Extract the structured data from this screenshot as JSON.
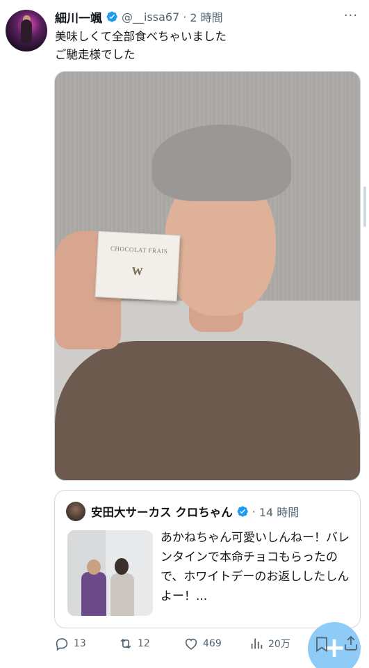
{
  "post": {
    "author_name": "細川一颯",
    "handle": "@__issa67",
    "separator": "·",
    "time": "2 時間",
    "more": "···",
    "text_line1": "美味しくて全部食べちゃいました",
    "text_line2": "ご馳走様でした",
    "media": {
      "box_text": "CHOCOLAT FRAIS",
      "box_logo": "W"
    }
  },
  "quote": {
    "author_name": "安田大サーカス クロちゃん",
    "separator": "·",
    "time": "14 時間",
    "text": "あかねちゃん可愛いしんねー！バレンタインで本命チョコもらったので、ホワイトデーのお返ししたしんよー！..."
  },
  "actions": {
    "replies": "13",
    "reposts": "12",
    "likes": "469",
    "views": "20万"
  },
  "fab": {
    "label": "+"
  },
  "colors": {
    "verified": "#1d9bf0",
    "secondary_text": "#536471",
    "fab": "#8fcbf7"
  }
}
